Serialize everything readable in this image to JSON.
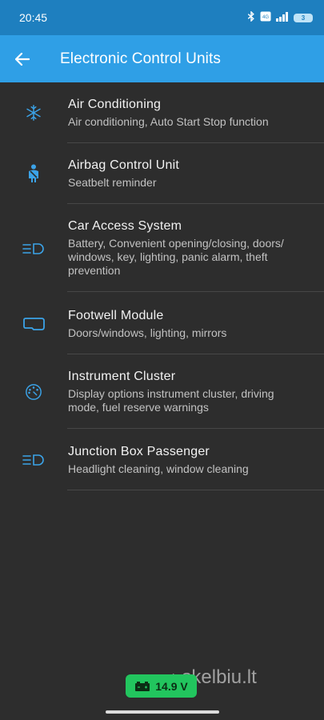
{
  "status_bar": {
    "time": "20:45",
    "battery": "3"
  },
  "app_bar": {
    "title": "Electronic Control Units"
  },
  "units": [
    {
      "name": "Air Conditioning",
      "description": "Air conditioning, Auto Start Stop function",
      "icon": "snowflake-icon"
    },
    {
      "name": "Airbag Control Unit",
      "description": "Seatbelt reminder",
      "icon": "seatbelt-icon"
    },
    {
      "name": "Car Access System",
      "description": "Battery, Convenient opening/closing, doors/ windows, key, lighting, panic alarm, theft prevention",
      "icon": "headlight-icon"
    },
    {
      "name": "Footwell Module",
      "description": "Doors/windows, lighting, mirrors",
      "icon": "mirror-icon"
    },
    {
      "name": "Instrument Cluster",
      "description": "Display options instrument cluster, driving mode, fuel reserve warnings",
      "icon": "gauge-icon"
    },
    {
      "name": "Junction Box Passenger",
      "description": "Headlight cleaning, window cleaning",
      "icon": "headlight-icon"
    }
  ],
  "voltage": {
    "value": "14.9 V"
  },
  "watermark": "skelbiu.lt",
  "colors": {
    "status_bar": "#1e7fbf",
    "app_bar": "#2f9fe6",
    "background": "#2d2d2d",
    "icon": "#3ba3e8",
    "voltage_badge": "#22c55e"
  }
}
